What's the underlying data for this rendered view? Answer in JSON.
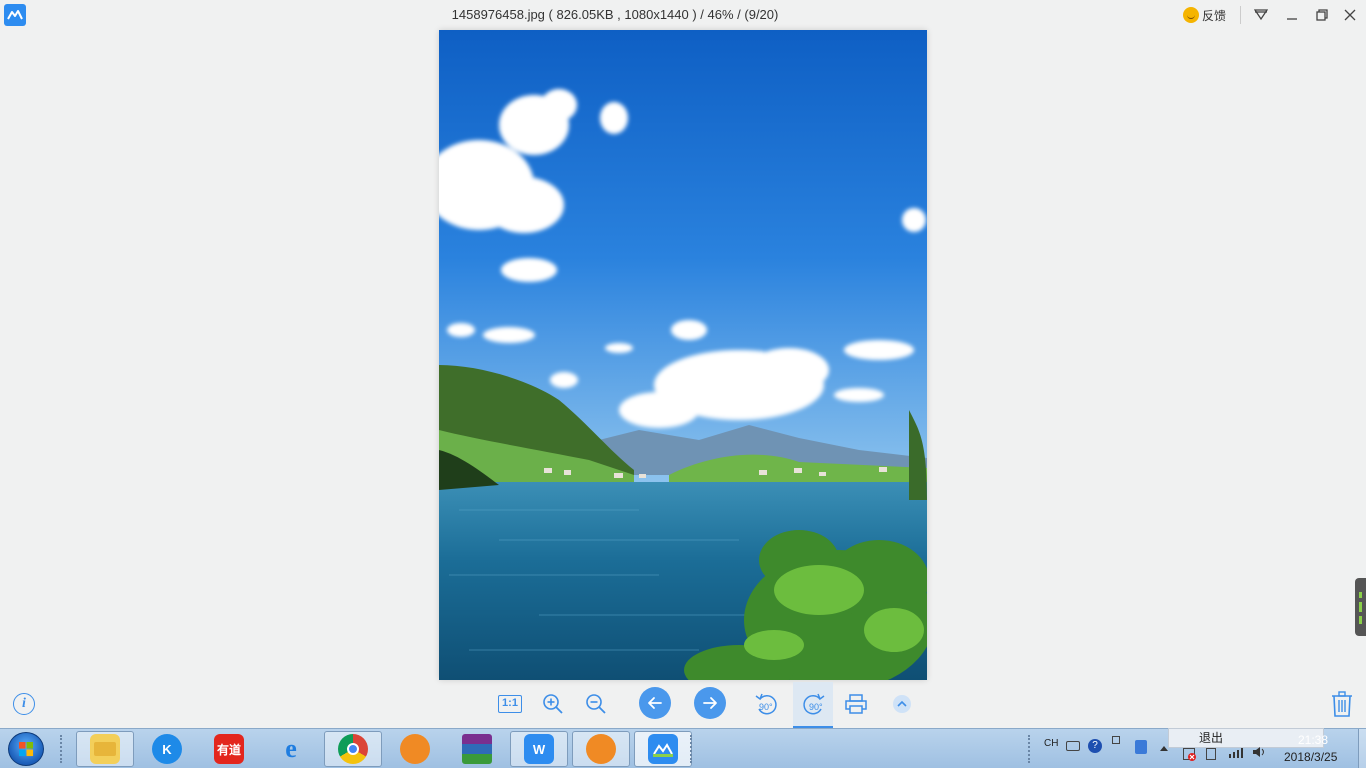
{
  "window": {
    "title": "1458976458.jpg ( 826.05KB , 1080x1440 ) / 46% / (9/20)",
    "feedback_label": "反馈",
    "icons": [
      "app-logo-icon",
      "smiley-icon",
      "skin-icon",
      "minimize-icon",
      "restore-icon"
    ]
  },
  "image": {
    "description_icon": "lake-landscape-photo",
    "colors": {
      "sky": "#1c6fd0",
      "water": "#1a6f9a",
      "grass": "#5fae3c"
    }
  },
  "toolbar": {
    "actual_size_label": "1:1",
    "rotate_left_label": "90°",
    "rotate_right_label": "90°",
    "icons": [
      "info-icon",
      "zoom-in-icon",
      "zoom-out-icon",
      "prev-icon",
      "next-icon",
      "rotate-left-icon",
      "rotate-right-icon",
      "print-icon",
      "collapse-icon",
      "trash-icon"
    ],
    "accent": "#3d8ee8"
  },
  "taskbar": {
    "apps": [
      {
        "name": "file-explorer",
        "label": ""
      },
      {
        "name": "kugou",
        "label": "K"
      },
      {
        "name": "youdao",
        "label": "有道"
      },
      {
        "name": "internet-explorer",
        "label": "e"
      },
      {
        "name": "chrome",
        "label": ""
      },
      {
        "name": "app-orange-1",
        "label": ""
      },
      {
        "name": "winrar",
        "label": ""
      },
      {
        "name": "wps",
        "label": "W"
      },
      {
        "name": "app-orange-2",
        "label": ""
      },
      {
        "name": "photo-viewer",
        "label": ""
      }
    ],
    "lang": "CH",
    "exit_label": "退出",
    "time": "21:38",
    "date": "2018/3/25"
  }
}
